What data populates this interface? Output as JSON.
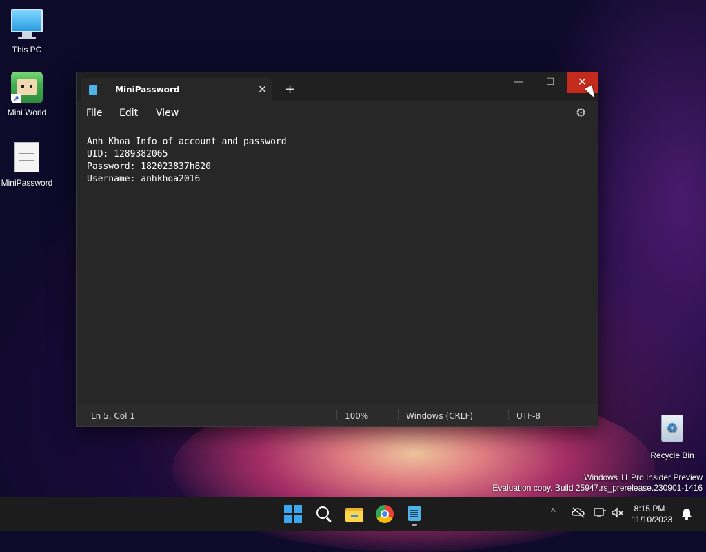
{
  "desktop": {
    "icons": [
      {
        "label": "This PC"
      },
      {
        "label": "Mini World"
      },
      {
        "label": "MiniPassword"
      },
      {
        "label": "Recycle Bin"
      }
    ]
  },
  "window": {
    "tab_title": "MiniPassword",
    "tab_close": "✕",
    "new_tab": "+",
    "minimize": "—",
    "maximize": "☐",
    "close": "✕",
    "menu": {
      "file": "File",
      "edit": "Edit",
      "view": "View"
    },
    "settings_icon": "⚙",
    "content": "Anh Khoa Info of account and password\nUID: 1289382065\nPassword: 182023837h820\nUsername: anhkhoa2016",
    "status": {
      "position": "Ln 5, Col 1",
      "zoom": "100%",
      "line_ending": "Windows (CRLF)",
      "encoding": "UTF-8"
    }
  },
  "watermark": {
    "line1": "Windows 11 Pro Insider Preview",
    "line2": "Evaluation copy. Build 25947.rs_prerelease.230901-1416"
  },
  "taskbar": {
    "tray_chevron": "^",
    "time": "8:15 PM",
    "date": "11/10/2023"
  }
}
